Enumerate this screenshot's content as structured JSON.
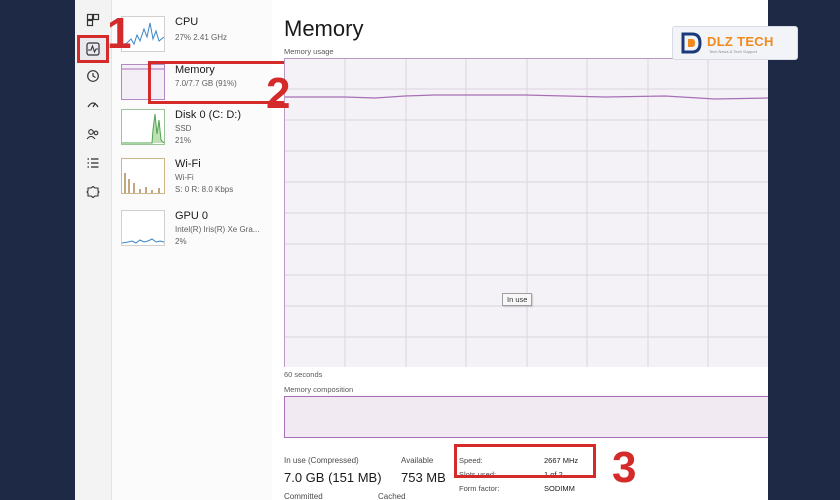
{
  "rail": {
    "icons": [
      "processes-icon",
      "performance-icon",
      "app-history-icon",
      "startup-apps-icon",
      "users-icon",
      "details-icon",
      "services-icon"
    ]
  },
  "perf_list": {
    "items": [
      {
        "name": "CPU",
        "sub1": "27%  2.41 GHz"
      },
      {
        "name": "Memory",
        "sub1": "7.0/7.7 GB (91%)"
      },
      {
        "name": "Disk 0 (C: D:)",
        "sub1": "SSD",
        "sub2": "21%"
      },
      {
        "name": "Wi-Fi",
        "sub1": "Wi-Fi",
        "sub2": "S: 0  R: 8.0 Kbps"
      },
      {
        "name": "GPU 0",
        "sub1": "Intel(R) Iris(R) Xe Gra...",
        "sub2": "2%"
      }
    ]
  },
  "main": {
    "title": "Memory",
    "usage_label": "Memory usage",
    "in_use_tooltip": "In use",
    "time_label": "60 seconds",
    "composition_label": "Memory composition",
    "memory_usage_percent": 91,
    "stats": {
      "in_use_label": "In use (Compressed)",
      "in_use_value": "7.0 GB (151 MB)",
      "available_label": "Available",
      "available_value": "753 MB",
      "committed_label": "Committed",
      "cached_label": "Cached"
    },
    "specs": {
      "speed_key": "Speed:",
      "speed_val": "2667 MHz",
      "slots_key": "Slots used:",
      "slots_val": "1 of 2",
      "form_key": "Form factor:",
      "form_val": "SODIMM"
    }
  },
  "annotations": [
    "1",
    "2",
    "3"
  ],
  "logo": {
    "text": "DLZ TECH",
    "tagline": "Tech News & Tech Support"
  },
  "colors": {
    "accent_red": "#d42a2a",
    "memory_purple": "#a86fb5",
    "background": "#1e2a45"
  }
}
